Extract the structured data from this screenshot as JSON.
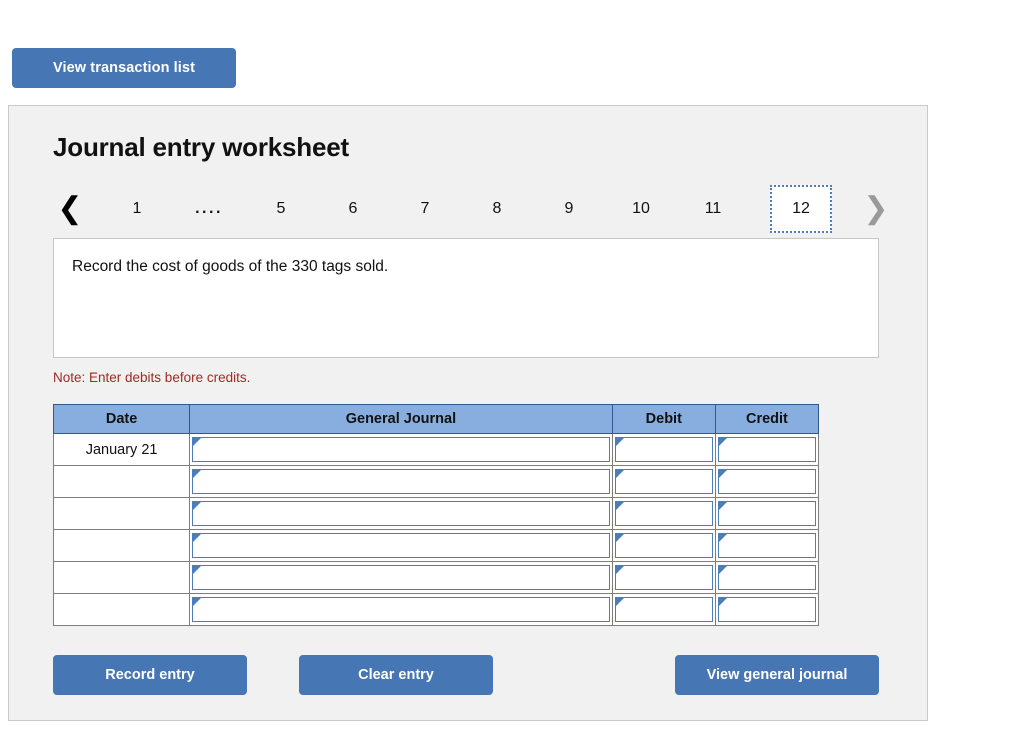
{
  "top_bar": {
    "view_transaction_list_label": "View transaction list"
  },
  "panel": {
    "title": "Journal entry worksheet",
    "pager": {
      "prev_icon": "chevron-left-icon",
      "next_icon": "chevron-right-icon",
      "pages": [
        {
          "label": "1",
          "type": "page",
          "active": false
        },
        {
          "label": "....",
          "type": "ellipsis",
          "active": false
        },
        {
          "label": "5",
          "type": "page",
          "active": false
        },
        {
          "label": "6",
          "type": "page",
          "active": false
        },
        {
          "label": "7",
          "type": "page",
          "active": false
        },
        {
          "label": "8",
          "type": "page",
          "active": false
        },
        {
          "label": "9",
          "type": "page",
          "active": false
        },
        {
          "label": "10",
          "type": "page",
          "active": false
        },
        {
          "label": "11",
          "type": "page",
          "active": false
        },
        {
          "label": "12",
          "type": "page",
          "active": true
        }
      ]
    },
    "instruction": "Record the cost of goods of the 330 tags sold.",
    "note": "Note: Enter debits before credits.",
    "table": {
      "headers": [
        "Date",
        "General Journal",
        "Debit",
        "Credit"
      ],
      "rows": [
        {
          "date": "January 21",
          "general_journal": "",
          "debit": "",
          "credit": ""
        },
        {
          "date": "",
          "general_journal": "",
          "debit": "",
          "credit": ""
        },
        {
          "date": "",
          "general_journal": "",
          "debit": "",
          "credit": ""
        },
        {
          "date": "",
          "general_journal": "",
          "debit": "",
          "credit": ""
        },
        {
          "date": "",
          "general_journal": "",
          "debit": "",
          "credit": ""
        },
        {
          "date": "",
          "general_journal": "",
          "debit": "",
          "credit": ""
        }
      ]
    },
    "actions": {
      "record_entry_label": "Record entry",
      "clear_entry_label": "Clear entry",
      "view_general_journal_label": "View general journal"
    }
  },
  "colors": {
    "button_blue": "#4776B4",
    "header_blue": "#88AEE0",
    "cell_border_blue": "#4A7EBB",
    "note_red": "#9E2A20",
    "panel_bg": "#F1F1F1"
  }
}
